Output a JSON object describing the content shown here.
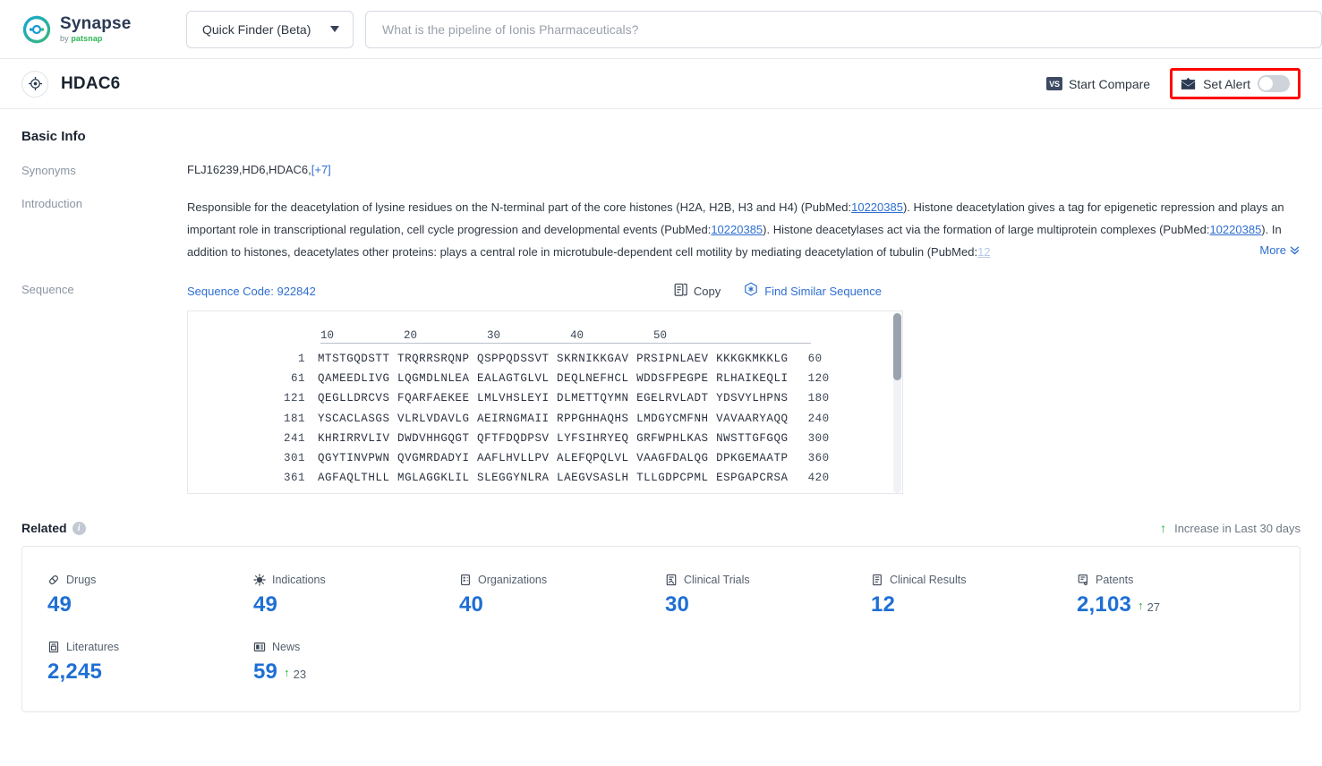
{
  "brand": {
    "name": "Synapse",
    "by_prefix": "by ",
    "by_name": "patsnap",
    "logo_colors": {
      "blue": "#1b9ad6",
      "green": "#3cb878"
    }
  },
  "topbar": {
    "finder_select_label": "Quick Finder (Beta)",
    "search_placeholder": "What is the pipeline of Ionis Pharmaceuticals?",
    "search_value": ""
  },
  "entity_header": {
    "title": "HDAC6",
    "target_icon": "target-icon",
    "start_compare_label": "Start Compare",
    "vs_badge_label": "VS",
    "set_alert_label": "Set Alert",
    "alert_toggle_state": "off",
    "highlight_color": "#ff0000"
  },
  "basic_info": {
    "section_title": "Basic Info",
    "synonyms": {
      "label": "Synonyms",
      "value": "FLJ16239,HD6,HDAC6,",
      "more_count": "[+7]"
    },
    "introduction": {
      "label": "Introduction",
      "part1": "Responsible for the deacetylation of lysine residues on the N-terminal part of the core histones (H2A, H2B, H3 and H4) (PubMed:",
      "pmid1": "10220385",
      "part2": "). Histone deacetylation gives a tag for epigenetic repression and plays an important role in transcriptional regulation, cell cycle progression and developmental events (PubMed:",
      "pmid2": "10220385",
      "part3": "). Histone deacetylases act via the formation of large multiprotein complexes (PubMed:",
      "pmid3": "10220385",
      "part4": "). In addition to histones, deacetylates other proteins: plays a central role in microtubule-dependent cell motility by mediating deacetylation of tubulin (PubMed:",
      "pmid4_trunc": "12",
      "more_label": "More"
    },
    "sequence": {
      "label": "Sequence",
      "code_label": "Sequence Code: 922842",
      "copy_label": "Copy",
      "find_similar_label": "Find Similar Sequence",
      "ruler": [
        "10",
        "20",
        "30",
        "40",
        "50"
      ],
      "lines": [
        {
          "start": "1",
          "end": "60",
          "chunks": [
            "MTSTGQDSTT",
            "TRQRRSRQNP",
            "QSPPQDSSVT",
            "SKRNIKKGAV",
            "PRSIPNLAEV",
            "KKKGKMKKLG"
          ]
        },
        {
          "start": "61",
          "end": "120",
          "chunks": [
            "QAMEEDLIVG",
            "LQGMDLNLEA",
            "EALAGTGLVL",
            "DEQLNEFHCL",
            "WDDSFPEGPE",
            "RLHAIKEQLI"
          ]
        },
        {
          "start": "121",
          "end": "180",
          "chunks": [
            "QEGLLDRCVS",
            "FQARFAEKEE",
            "LMLVHSLEYI",
            "DLMETTQYMN",
            "EGELRVLADT",
            "YDSVYLHPNS"
          ]
        },
        {
          "start": "181",
          "end": "240",
          "chunks": [
            "YSCACLASGS",
            "VLRLVDAVLG",
            "AEIRNGMAII",
            "RPPGHHAQHS",
            "LMDGYCMFNH",
            "VAVAARYAQQ"
          ]
        },
        {
          "start": "241",
          "end": "300",
          "chunks": [
            "KHRIRRVLIV",
            "DWDVHHGQGT",
            "QFTFDQDPSV",
            "LYFSIHRYEQ",
            "GRFWPHLKAS",
            "NWSTTGFGQG"
          ]
        },
        {
          "start": "301",
          "end": "360",
          "chunks": [
            "QGYTINVPWN",
            "QVGMRDADYI",
            "AAFLHVLLPV",
            "ALEFQPQLVL",
            "VAAGFDALQG",
            "DPKGEMAATP"
          ]
        },
        {
          "start": "361",
          "end": "420",
          "chunks": [
            "AGFAQLTHLL",
            "MGLAGGKLIL",
            "SLEGGYNLRA",
            "LAEGVSASLH",
            "TLLGDPCPML",
            "ESPGAPCRSA"
          ]
        }
      ]
    }
  },
  "related": {
    "title": "Related",
    "info_icon": "info-icon",
    "increase_note": "Increase in Last 30 days",
    "stats": [
      {
        "label": "Drugs",
        "icon": "pill-icon",
        "value": "49",
        "delta": ""
      },
      {
        "label": "Indications",
        "icon": "virus-icon",
        "value": "49",
        "delta": ""
      },
      {
        "label": "Organizations",
        "icon": "building-icon",
        "value": "40",
        "delta": ""
      },
      {
        "label": "Clinical Trials",
        "icon": "clinical-trial-icon",
        "value": "30",
        "delta": ""
      },
      {
        "label": "Clinical Results",
        "icon": "clinical-result-icon",
        "value": "12",
        "delta": ""
      },
      {
        "label": "Patents",
        "icon": "patent-icon",
        "value": "2,103",
        "delta": "27"
      },
      {
        "label": "Literatures",
        "icon": "literature-icon",
        "value": "2,245",
        "delta": ""
      },
      {
        "label": "News",
        "icon": "news-icon",
        "value": "59",
        "delta": "23"
      }
    ]
  }
}
